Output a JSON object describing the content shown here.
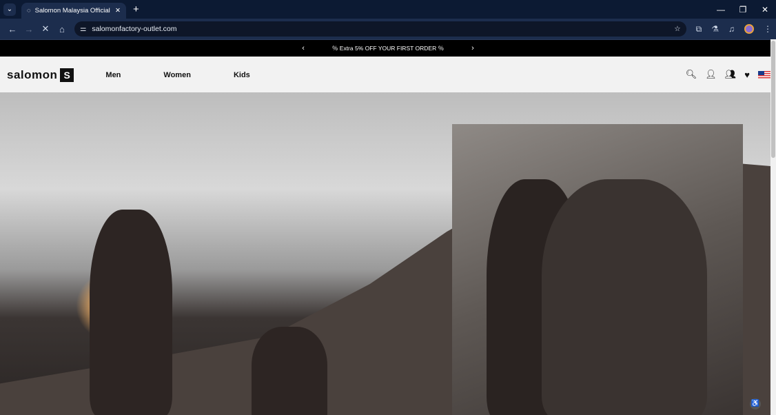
{
  "browser": {
    "tab_title": "Salomon Malaysia Official Website",
    "url": "salomonfactory-outlet.com"
  },
  "promo": {
    "text": "Extra 5% OFF YOUR FIRST ORDER",
    "prev": "‹",
    "next": "›"
  },
  "header": {
    "logo": "salomon",
    "nav": [
      "Men",
      "Women",
      "Kids"
    ]
  },
  "colors": {
    "chrome": "#1c2d4d",
    "promo_bg": "#000000",
    "header_bg": "#f2f2f2"
  }
}
